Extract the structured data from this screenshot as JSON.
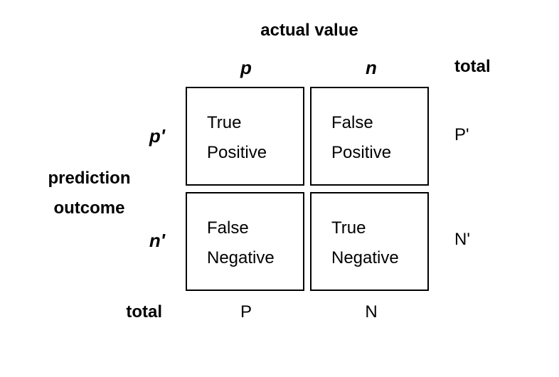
{
  "top_axis_title": "actual value",
  "column_headers": {
    "p": "p",
    "n": "n",
    "total": "total"
  },
  "row_headers": {
    "p_prime": "p'",
    "n_prime": "n'"
  },
  "side_axis_title": {
    "line1": "prediction",
    "line2": "outcome"
  },
  "cells": {
    "tp": {
      "line1": "True",
      "line2": "Positive"
    },
    "fp": {
      "line1": "False",
      "line2": "Positive"
    },
    "fn": {
      "line1": "False",
      "line2": "Negative"
    },
    "tn": {
      "line1": "True",
      "line2": "Negative"
    }
  },
  "row_totals": {
    "p_prime": "P'",
    "n_prime": "N'"
  },
  "bottom_row": {
    "label": "total",
    "p": "P",
    "n": "N"
  }
}
